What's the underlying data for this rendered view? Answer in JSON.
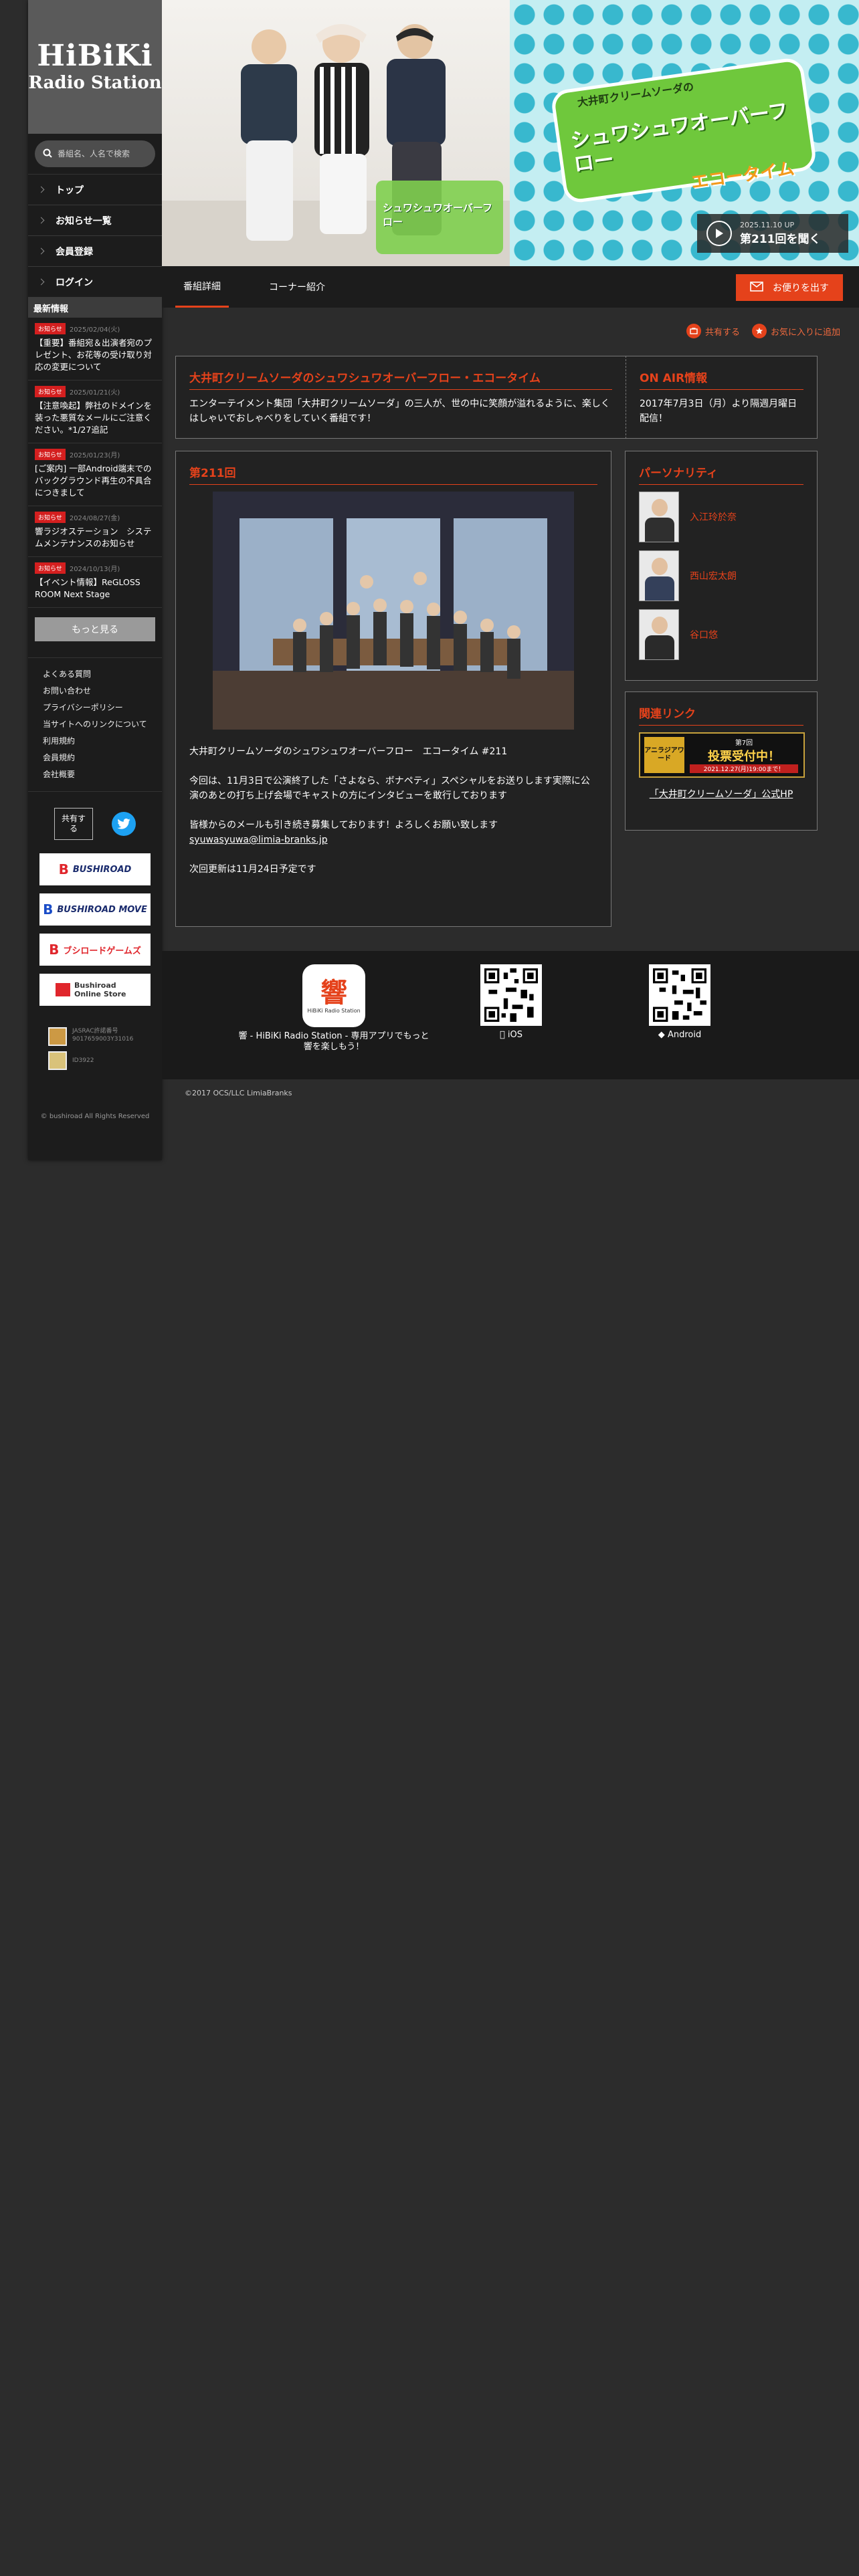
{
  "logo": {
    "line1": "HiBiKi",
    "line2": "Radio Station"
  },
  "search": {
    "placeholder": "番組名、人名で検索"
  },
  "nav": [
    {
      "label": "トップ"
    },
    {
      "label": "お知らせ一覧"
    },
    {
      "label": "会員登録"
    },
    {
      "label": "ログイン"
    }
  ],
  "news": {
    "heading": "最新情報",
    "items": [
      {
        "badge": "お知らせ",
        "date": "2025/02/04(火)",
        "text": "【重要】番組宛＆出演者宛のプレゼント、お花等の受け取り対応の変更について"
      },
      {
        "badge": "お知らせ",
        "date": "2025/01/21(火)",
        "text": "【注意喚起】弊社のドメインを装った悪質なメールにご注意ください。*1/27追記"
      },
      {
        "badge": "お知らせ",
        "date": "2025/01/23(月)",
        "text": "[ご案内] 一部Android端末でのバックグラウンド再生の不具合につきまして"
      },
      {
        "badge": "お知らせ",
        "date": "2024/08/27(金)",
        "text": "響ラジオステーション　システムメンテナンスのお知らせ"
      },
      {
        "badge": "お知らせ",
        "date": "2024/10/13(月)",
        "text": "【イベント情報】ReGLOSS ROOM Next Stage"
      }
    ],
    "more": "もっと見る"
  },
  "footer_links": [
    "よくある質問",
    "お問い合わせ",
    "プライバシーポリシー",
    "当サイトへのリンクについて",
    "利用規約",
    "会員規約",
    "会社概要"
  ],
  "share": {
    "label": "共有する"
  },
  "banners": [
    "BUSHIROAD",
    "BUSHIROAD MOVE",
    "ブシロードゲームズ",
    "Bushiroad Online Store"
  ],
  "jasrac": {
    "text1": "JASRAC許諾番号",
    "text2": "9017659003Y31016",
    "text3": "ID3922"
  },
  "side_copyright": "© bushiroad All Rights Reserved",
  "hero": {
    "logo_top": "大井町クリームソーダの",
    "logo_main": "シュワシュワオーバーフロー",
    "logo_sub": "エコータイム",
    "listen_date": "2025.11.10 UP",
    "listen_text": "第211回を聞く"
  },
  "tabs": [
    {
      "label": "番組詳細"
    },
    {
      "label": "コーナー紹介"
    }
  ],
  "mail_button": "お便りを出す",
  "actions": {
    "share": "共有する",
    "favorite": "お気に入りに追加"
  },
  "program": {
    "title": "大井町クリームソーダのシュワシュワオーバーフロー・エコータイム",
    "description": "エンターテイメント集団「大井町クリームソーダ」の三人が、世の中に笑顔が溢れるように、楽しくはしゃいでおしゃべりをしていく番組です！"
  },
  "onair": {
    "title": "ON AIR情報",
    "text": "2017年7月3日（月）より隔週月曜日配信！"
  },
  "episode": {
    "title": "第211回",
    "line1": "大井町クリームソーダのシュワシュワオーバーフロー　エコータイム #211",
    "line2": "今回は、11月3日で公演終了した「さよなら、ボナペティ」スペシャルをお送りします実際に公演のあとの打ち上げ会場でキャストの方にインタビューを敢行しております",
    "line3": "皆様からのメールも引き続き募集しております！よろしくお願い致します",
    "email": "syuwasyuwa@limia-branks.jp",
    "line4": "次回更新は11月24日予定です"
  },
  "personality": {
    "title": "パーソナリティ",
    "people": [
      {
        "name": "入江玲於奈"
      },
      {
        "name": "西山宏太朗"
      },
      {
        "name": "谷口悠"
      }
    ]
  },
  "related": {
    "title": "関連リンク",
    "banner_small": "第7回",
    "banner_main": "投票受付中！",
    "banner_date": "2021.12.27(月)19:00まで！",
    "banner_logo": "アニラジアワード",
    "official": "「大井町クリームソーダ」公式HP"
  },
  "app_footer": {
    "app_caption": "響 - HiBiKi Radio Station - 専用アプリでもっと響を楽しもう！",
    "ios": "iOS",
    "android": "Android"
  },
  "copyright": "©2017 OCS/LLC LimiaBranks",
  "colors": {
    "accent": "#e5421b",
    "badge": "#d41f1f",
    "twitter": "#1da1f2"
  }
}
